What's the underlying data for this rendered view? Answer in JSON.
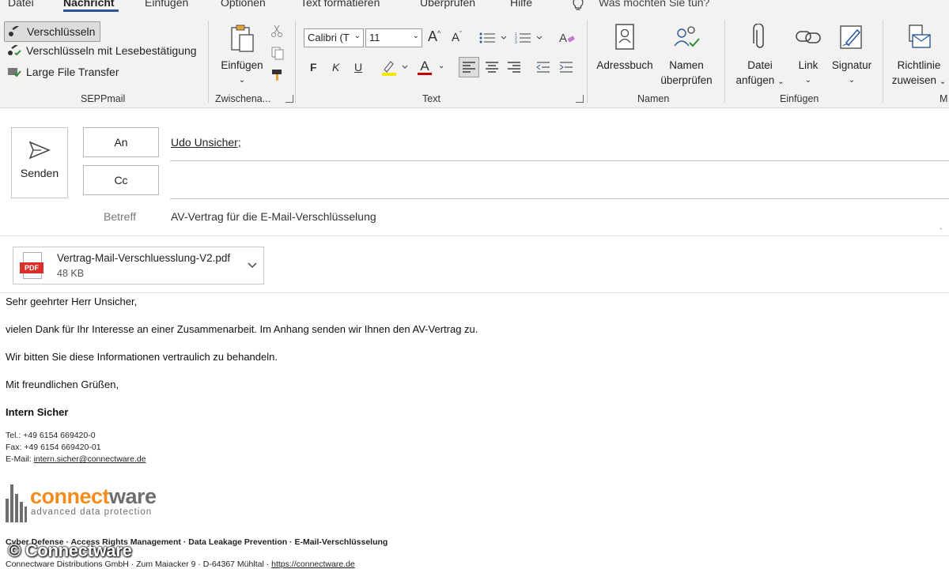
{
  "tabs": [
    "Datei",
    "Nachricht",
    "Einfügen",
    "Optionen",
    "Text formatieren",
    "Überprüfen",
    "Hilfe"
  ],
  "tell_me": "Was möchten Sie tun?",
  "seppmail": {
    "items": [
      "Verschlüsseln",
      "Verschlüsseln mit Lesebestätigung",
      "Large File Transfer"
    ],
    "label": "SEPPmail"
  },
  "clipboard": {
    "paste_label": "Einfügen",
    "label": "Zwischena..."
  },
  "text_group": {
    "font": "Calibri (T",
    "size": "11",
    "bold": "F",
    "italic": "K",
    "underline": "U",
    "grow": "A",
    "shrink": "A",
    "font_color": "A",
    "label": "Text"
  },
  "names_group": {
    "address_book": "Adressbuch",
    "check_names_1": "Namen",
    "check_names_2": "überprüfen",
    "label": "Namen"
  },
  "insert_group": {
    "attach_1": "Datei",
    "attach_2": "anfügen",
    "link": "Link",
    "signature": "Signatur",
    "label": "Einfügen"
  },
  "policy_group": {
    "policy_1": "Richtlinie",
    "policy_2": "zuweisen",
    "label": "M"
  },
  "compose": {
    "send": "Senden",
    "to_label": "An",
    "to_value": "Udo Unsicher;",
    "cc_label": "Cc",
    "cc_value": "",
    "subject_label": "Betreff",
    "subject_value": "AV-Vertrag für die E-Mail-Verschlüsselung"
  },
  "attachment": {
    "icon_text": "PDF",
    "name": "Vertrag-Mail-Verschluesslung-V2.pdf",
    "size": "48 KB"
  },
  "body": {
    "greeting": "Sehr geehrter Herr Unsicher,",
    "p1": "vielen Dank für Ihr Interesse an einer Zusammenarbeit. Im Anhang senden wir Ihnen den AV-Vertrag zu.",
    "p2": "Wir bitten Sie diese Informationen vertraulich zu behandeln.",
    "closing": "Mit freundlichen Grüßen,",
    "name": "Intern Sicher",
    "tel": "Tel.: +49 6154 669420-0",
    "fax": "Fax: +49 6154 669420-01",
    "email_label": "E-Mail: ",
    "email": "intern.sicher@connectware.de",
    "logo_main_1": "connect",
    "logo_main_2": "ware",
    "logo_sub": "advanced data protection",
    "services": "Cyber Defense · Access Rights Management · Data Leakage Prevention · E-Mail-Verschlüsselung",
    "address": "Connectware Distributions GmbH · Zum Maiacker 9 · D-64367 Mühltal · ",
    "website": "https://connectware.de"
  },
  "watermark": "© Connectware",
  "colors": {
    "accent": "#2b579a",
    "logo_orange": "#f28c1c",
    "pdf_red": "#d9302c",
    "logo_gray": "#6d6e70"
  }
}
